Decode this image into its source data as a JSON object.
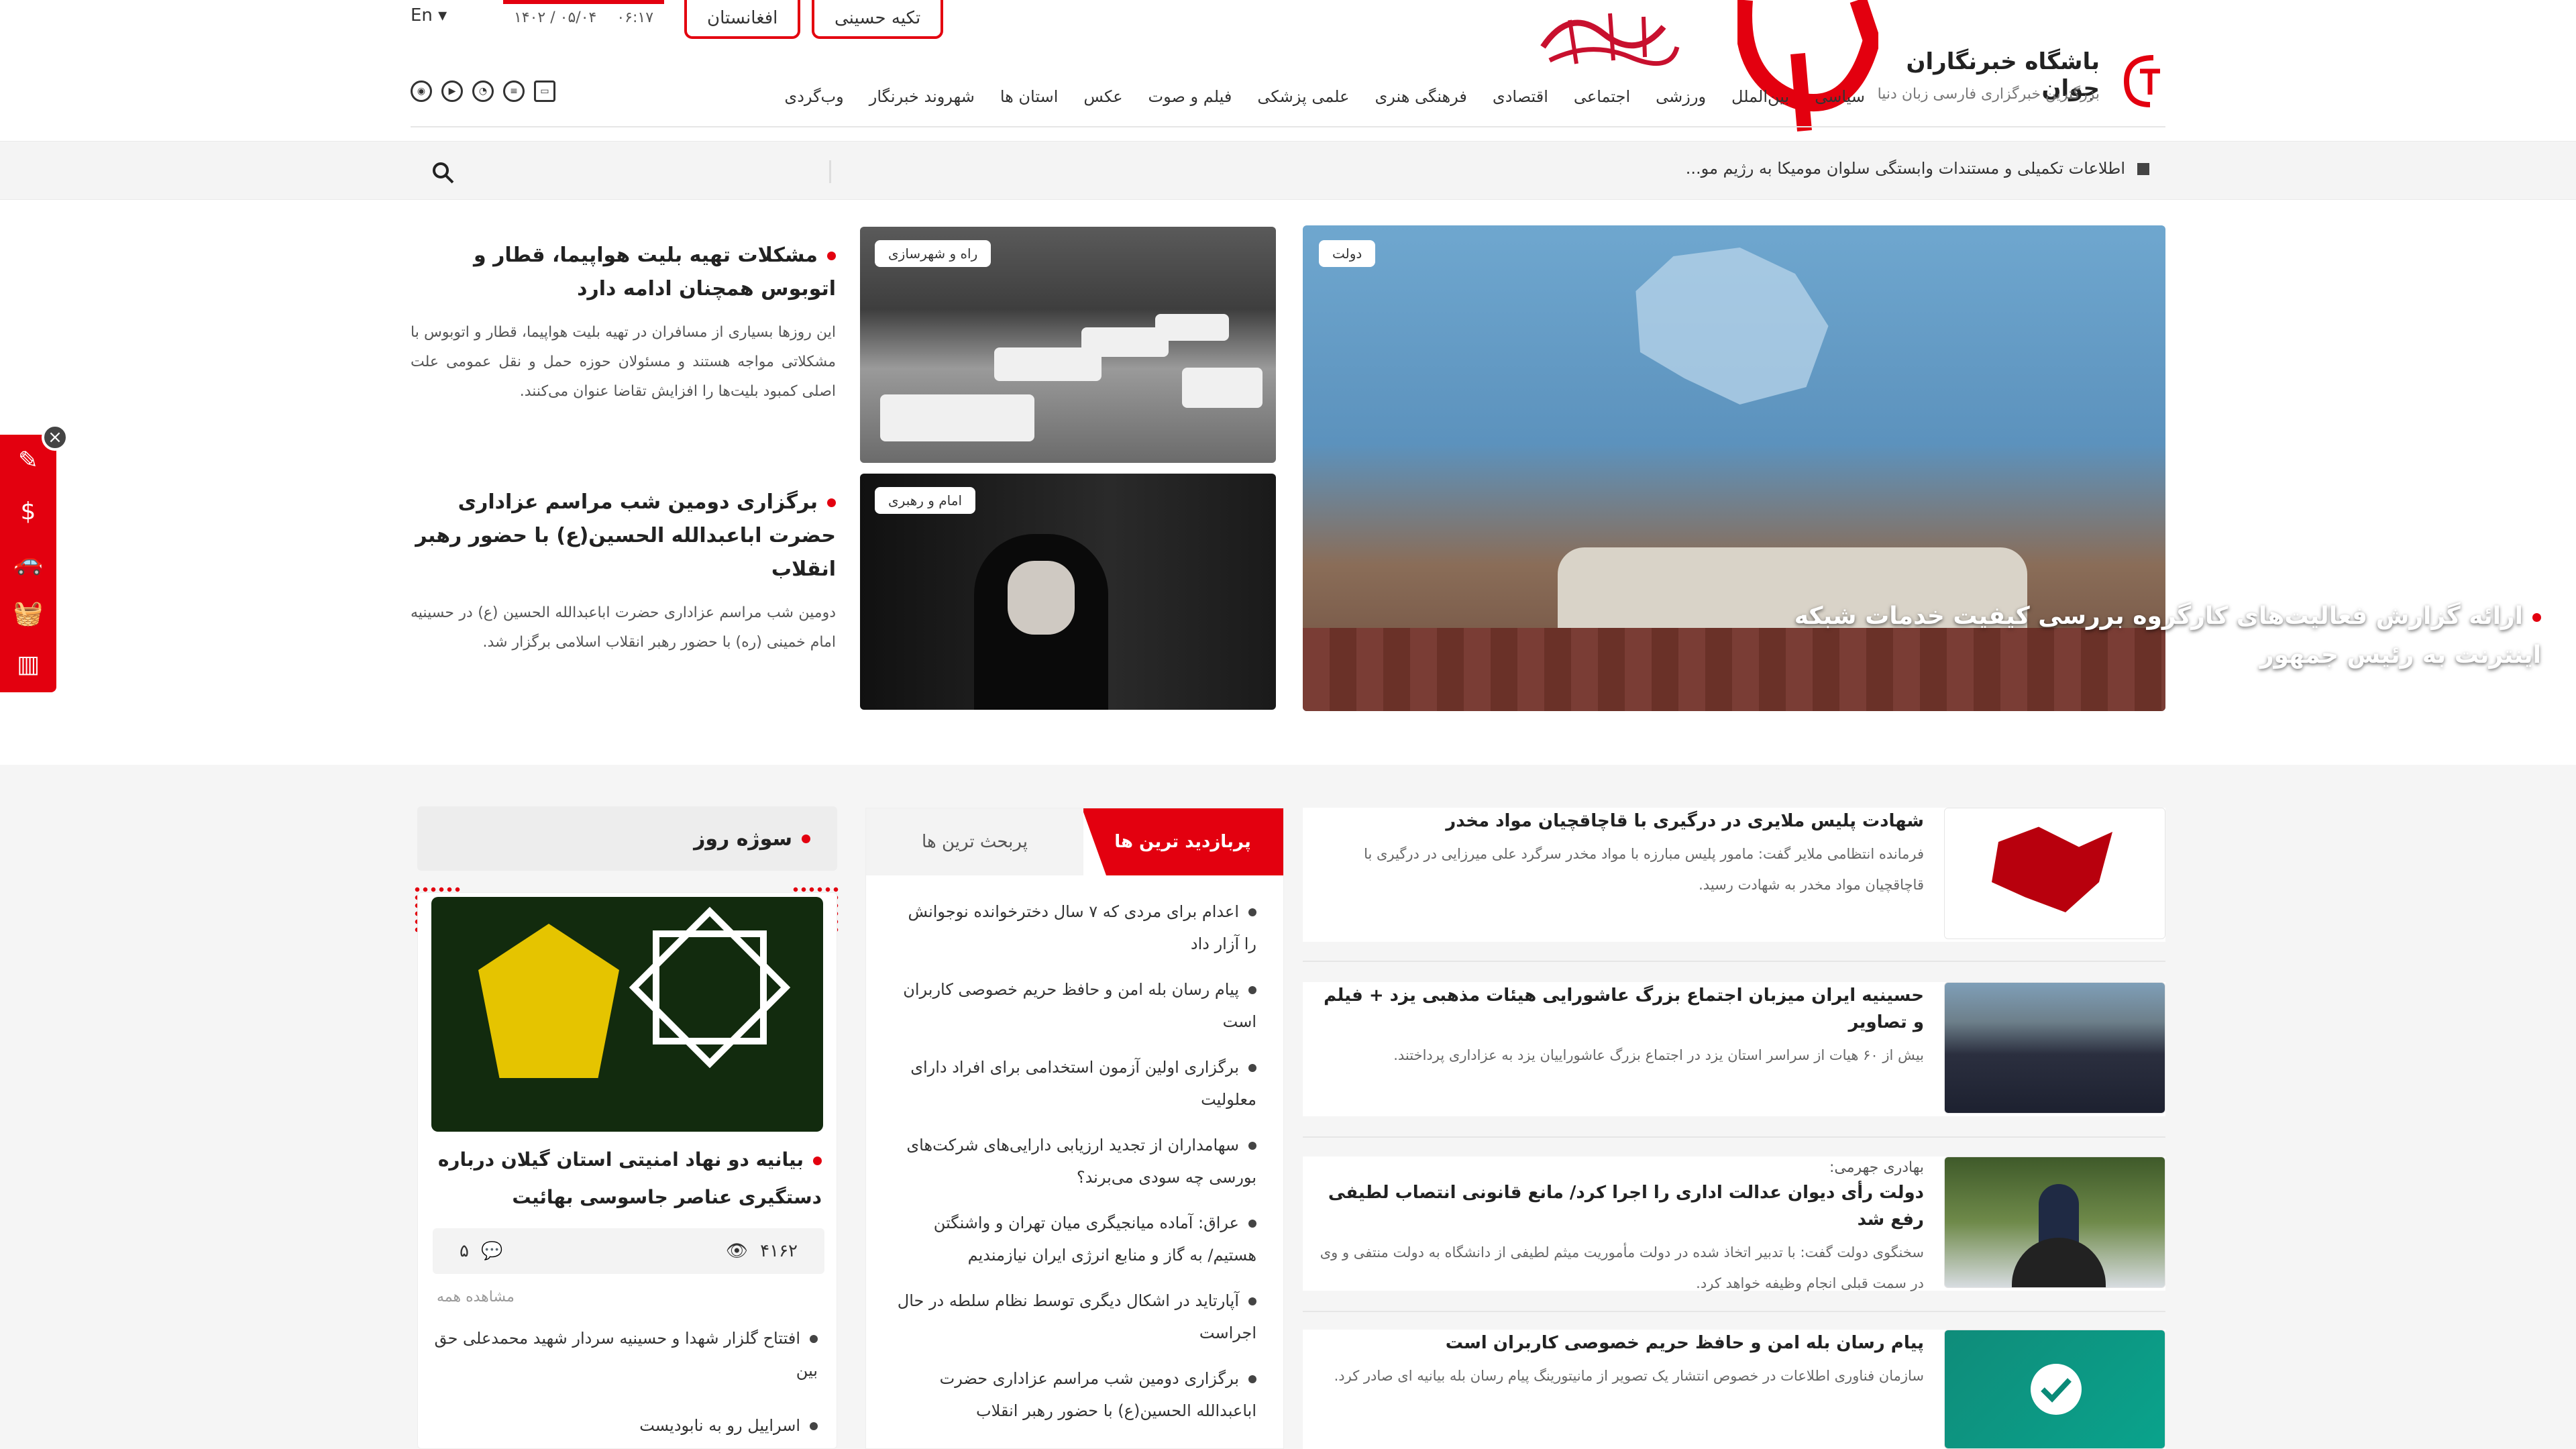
{
  "header": {
    "lang": "En ▾",
    "time": "۰۶:۱۷",
    "date": "۱۴۰۲ / ۰۵/۰۴",
    "pills": [
      "افغانستان",
      "تکیه حسینی"
    ],
    "brand_title": "باشگاه خبرنگاران جوان",
    "brand_sub": "بزرگترین خبرگزاری فارسی زبان دنیا",
    "nav": [
      "سیاسی",
      "بین‌الملل",
      "ورزشی",
      "اجتماعی",
      "اقتصادی",
      "فرهنگی هنری",
      "علمی پزشکی",
      "فیلم و صوت",
      "عکس",
      "استان ها",
      "شهروند خبرنگار",
      "وب‌گردی"
    ],
    "brand_color": "#e3000f"
  },
  "ticker": {
    "text": "اطلاعات تکمیلی و مستندات وابستگی سلوان مومیکا به رژیم مو..."
  },
  "hero": {
    "main_tag": "دولت",
    "main_caption": "ارائه گزارش فعالیت‌های کارگروه بررسی کیفیت خدمات شبکه اینترنت به رئیس جمهور",
    "small1_tag": "راه و شهرسازی",
    "small2_tag": "امام و رهبری",
    "story1_title": "مشکلات تهیه بلیت هواپیما، قطار و اتوبوس همچنان ادامه دارد",
    "story1_text": "این روزها بسیاری از مسافران در تهیه بلیت هواپیما، قطار و اتوبوس با مشکلاتی مواجه هستند و مسئولان حوزه حمل و نقل عمومی علت اصلی کمبود بلیت‌ها را افزایش تقاضا عنوان می‌کنند.",
    "story2_title": "برگزاری دومین شب مراسم عزاداری حضرت اباعبدالله الحسین(ع) با حضور رهبر انقلاب",
    "story2_text": "دومین شب مراسم عزاداری حضرت اباعبدالله الحسین (ع) در حسینیه امام خمینی (ره) با حضور رهبر انقلاب اسلامی برگزار شد."
  },
  "news": [
    {
      "title": "شهادت پلیس ملایری در درگیری با قاچاقچیان مواد مخدر",
      "pre": "",
      "text": "فرمانده انتظامی ملایر گفت: مامور پلیس مبارزه با مواد مخدر سرگرد علی میرزایی در درگیری با قاچاقچیان مواد مخدر به شهادت رسید."
    },
    {
      "title": "حسینیه ایران میزبان اجتماع بزرگ عاشورایی هیئات مذهبی یزد + فیلم و تصاویر",
      "pre": "",
      "text": "بیش از ۶۰ هیات از سراسر استان یزد در اجتماع بزرگ عاشوراییان یزد به عزاداری پرداختند."
    },
    {
      "title": "دولت رأی دیوان عدالت اداری را اجرا کرد/ مانع قانونی انتصاب لطیفی رفع شد",
      "pre": "بهادری جهرمی:",
      "text": "سخنگوی دولت گفت: با تدبیر اتخاذ شده در دولت مأموریت میثم لطیفی از دانشگاه به دولت منتفی و وی در سمت قبلی انجام وظیفه خواهد کرد."
    },
    {
      "title": "پیام رسان بله امن و حافظ حریم خصوصی کاربران است",
      "pre": "",
      "text": "سازمان فناوری اطلاعات در خصوص انتشار یک تصویر از مانیتورینگ پیام رسان بله بیانیه ای صادر کرد."
    }
  ],
  "tabs": {
    "active": "پربازدید ترین ها",
    "inactive": "پربحث ترین ها",
    "items": [
      "اعدام برای مردی که ۷ سال دخترخوانده نوجوانش را آزار داد",
      "پیام رسان بله امن و حافظ حریم خصوصی کاربران است",
      "برگزاری اولین آزمون استخدامی برای افراد دارای معلولیت",
      "سهامداران از تجدید ارزیابی دارایی‌های شرکت‌های بورسی چه سودی می‌برند؟",
      "عراق: آماده میانجیگری میان تهران و واشنگتن هستیم/ به گاز و منابع انرژی ایران نیازمندیم",
      "آپارتاید در اشکال دیگری توسط نظام سلطه در حال اجراست",
      "برگزاری دومین شب مراسم عزاداری حضرت اباعبدالله الحسین(ع) با حضور رهبر انقلاب"
    ]
  },
  "hot": {
    "heading": "سوژه روز",
    "title": "بیانیه دو نهاد امنیتی استان گیلان درباره دستگیری عناصر جاسوسی بهائیت",
    "views": "۴۱۶۲",
    "comments": "۵",
    "see_all": "مشاهده همه",
    "list": [
      "افتتاح گلزار شهدا و حسینیه سردار شهید محمدعلی حق بین",
      "اسراییل رو به نابودیست"
    ]
  }
}
